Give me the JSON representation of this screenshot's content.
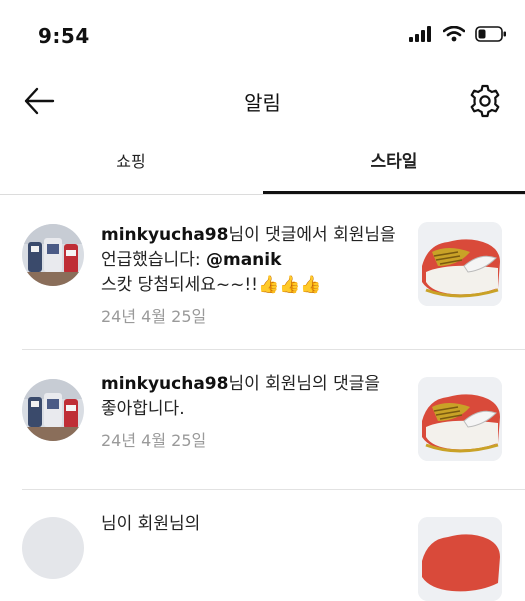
{
  "status": {
    "time": "9:54"
  },
  "header": {
    "title": "알림"
  },
  "tabs": [
    {
      "label": "쇼핑"
    },
    {
      "label": "스타일"
    }
  ],
  "notifications": [
    {
      "username": "minkyucha98",
      "message": "님이 댓글에서 회원님을 언급했습니다: ",
      "mention": "@manik",
      "extra": "스캇 당첨되세요~~!!",
      "emoji": "👍👍👍",
      "date": "24년 4월 25일"
    },
    {
      "username": "minkyucha98",
      "message": "님이 회원님의 댓글을 좋아합니다.",
      "date": "24년 4월 25일"
    },
    {
      "username": "",
      "message": "님이 회원님의"
    }
  ]
}
